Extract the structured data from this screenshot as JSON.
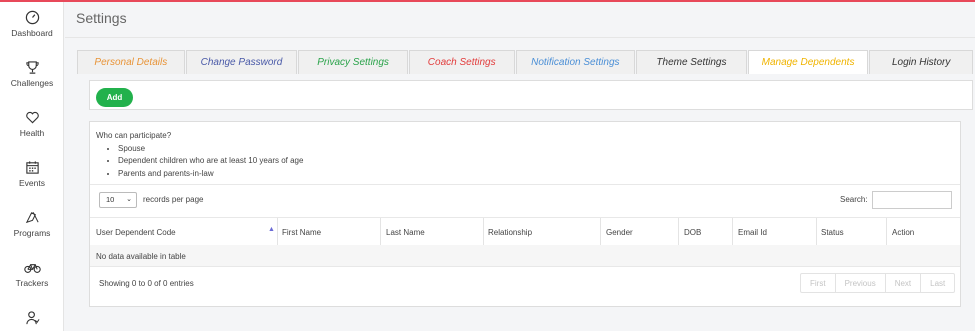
{
  "page_title": "Settings",
  "sidebar": {
    "items": [
      {
        "label": "Dashboard",
        "icon": "gauge-icon"
      },
      {
        "label": "Challenges",
        "icon": "trophy-icon"
      },
      {
        "label": "Health",
        "icon": "heart-icon"
      },
      {
        "label": "Events",
        "icon": "calendar-icon"
      },
      {
        "label": "Programs",
        "icon": "flags-icon"
      },
      {
        "label": "Trackers",
        "icon": "bicycle-icon"
      },
      {
        "label": "",
        "icon": "people-icon"
      }
    ]
  },
  "tabs": [
    {
      "label": "Personal Details",
      "color": "#e89438"
    },
    {
      "label": "Change Password",
      "color": "#4a5aa8"
    },
    {
      "label": "Privacy Settings",
      "color": "#2aa34a"
    },
    {
      "label": "Coach Settings",
      "color": "#e23d3d"
    },
    {
      "label": "Notification Settings",
      "color": "#4b8fd6"
    },
    {
      "label": "Theme Settings",
      "color": "#333333"
    },
    {
      "label": "Manage Dependents",
      "color": "#f0b400"
    },
    {
      "label": "Login History",
      "color": "#333333"
    }
  ],
  "active_tab": "Manage Dependents",
  "add_button_label": "Add",
  "eligibility": {
    "heading": "Who can participate?",
    "items": [
      "Spouse",
      "Dependent children who are at least 10 years of age",
      "Parents and parents-in-law"
    ]
  },
  "table": {
    "page_length": "10",
    "page_length_label": "records per page",
    "search_label": "Search:",
    "columns": [
      "User Dependent Code",
      "First Name",
      "Last Name",
      "Relationship",
      "Gender",
      "DOB",
      "Email Id",
      "Status",
      "Action"
    ],
    "empty_message": "No data available in table",
    "info": "Showing 0 to 0 of 0 entries",
    "pagination": [
      "First",
      "Previous",
      "Next",
      "Last"
    ]
  },
  "colors": {
    "accent_green": "#22b14c",
    "top_line": "#e8495a"
  }
}
